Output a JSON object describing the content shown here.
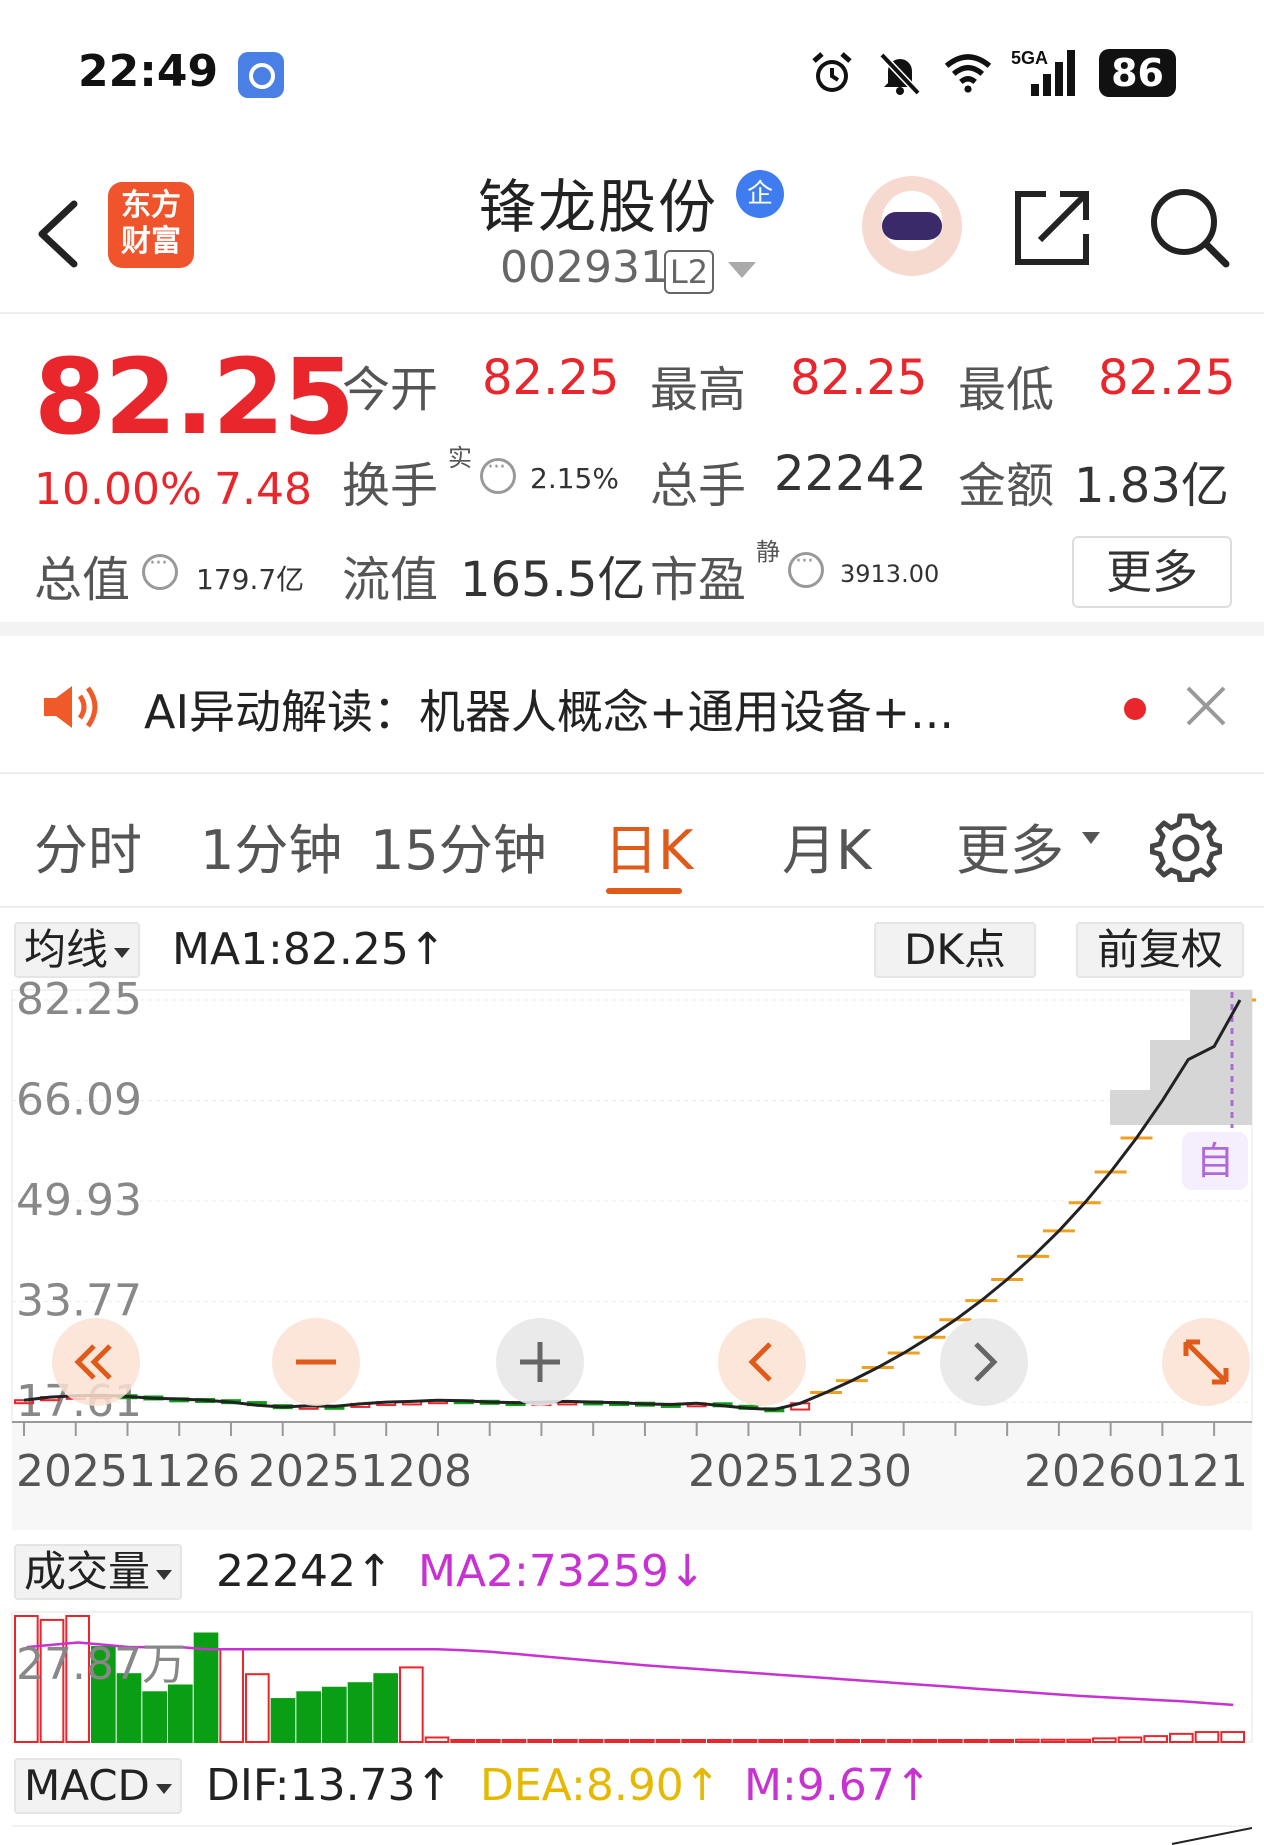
{
  "status": {
    "time": "22:49",
    "battery": "86",
    "net": "5GA"
  },
  "header": {
    "logo_line1": "东方",
    "logo_line2": "财富",
    "stock_name": "锋龙股份",
    "ent_badge": "企",
    "stock_code": "002931",
    "level": "L2"
  },
  "quote": {
    "price": "82.25",
    "change_pct": "10.00%",
    "change_amt": "7.48",
    "open_label": "今开",
    "open": "82.25",
    "high_label": "最高",
    "high": "82.25",
    "low_label": "最低",
    "low": "82.25",
    "turnover_label": "换手",
    "turnover_sup": "实",
    "turnover": "2.15%",
    "volume_label": "总手",
    "volume": "22242",
    "amount_label": "金额",
    "amount": "1.83亿",
    "mktcap_label": "总值",
    "mktcap": "179.7亿",
    "float_label": "流值",
    "float": "165.5亿",
    "pe_label": "市盈",
    "pe_sup": "静",
    "pe": "3913.00",
    "more": "更多"
  },
  "news": {
    "text": "AI异动解读：机器人概念+通用设备+..."
  },
  "tabs": [
    {
      "label": "分时"
    },
    {
      "label": "1分钟"
    },
    {
      "label": "15分钟"
    },
    {
      "label": "日K"
    },
    {
      "label": "月K"
    },
    {
      "label": "更多"
    }
  ],
  "kline": {
    "selector": "均线",
    "ma1": "MA1:82.25↑",
    "dk": "DK点",
    "adjust": "前复权",
    "auto": "自"
  },
  "volume_panel": {
    "selector": "成交量",
    "value": "22242↑",
    "ma2": "MA2:73259↓",
    "ylabel": "27.87万"
  },
  "macd_panel": {
    "selector": "MACD",
    "dif": "DIF:13.73↑",
    "dea": "DEA:8.90↑",
    "m": "M:9.67↑"
  },
  "colors": {
    "up": "#e8262c",
    "down": "#0a9e14",
    "accent": "#e05a1a",
    "ma_line": "#222222",
    "ma2": "#c832d2",
    "dea": "#e6b800"
  },
  "chart_data": [
    {
      "type": "candlestick",
      "ylim": [
        17.61,
        82.25
      ],
      "yticks": [
        "82.25",
        "66.09",
        "49.93",
        "33.77",
        "17.61"
      ],
      "xticks": [
        "20251126",
        "20251208",
        "20251230",
        "20260121"
      ],
      "closes": [
        17.9,
        18.4,
        18.6,
        18.7,
        18.5,
        18.2,
        18.1,
        17.9,
        17.6,
        17.1,
        16.8,
        17.0,
        16.9,
        17.3,
        17.6,
        17.7,
        17.9,
        17.8,
        17.6,
        17.5,
        17.6,
        17.7,
        17.6,
        17.5,
        17.3,
        17.2,
        17.4,
        17.0,
        16.6,
        16.4,
        17.4,
        19.14,
        21.05,
        23.16,
        25.48,
        28.03,
        30.83,
        33.91,
        37.3,
        41.03,
        45.13,
        49.64,
        54.6,
        60.06,
        66.07,
        72.68,
        74.77,
        82.25
      ],
      "ma1_label": "MA1"
    },
    {
      "type": "bar",
      "name": "成交量",
      "ylim": [
        0,
        27.87
      ],
      "values": [
        27.87,
        27.0,
        27.87,
        21.0,
        15.0,
        11.0,
        12.5,
        24.0,
        20.5,
        15.0,
        9.5,
        11.0,
        12.0,
        13.0,
        15.0,
        16.5,
        1.0,
        0.3,
        0.3,
        0.3,
        0.3,
        0.3,
        0.3,
        0.3,
        0.3,
        0.3,
        0.3,
        0.3,
        0.3,
        0.3,
        0.3,
        0.3,
        0.3,
        0.3,
        0.3,
        0.3,
        0.3,
        0.3,
        0.3,
        0.5,
        0.5,
        0.5,
        0.8,
        1.0,
        1.3,
        1.8,
        2.2,
        2.2
      ],
      "up": [
        true,
        true,
        true,
        false,
        false,
        false,
        false,
        false,
        true,
        true,
        false,
        false,
        false,
        false,
        false,
        true,
        true,
        true,
        true,
        true,
        true,
        true,
        true,
        true,
        true,
        true,
        true,
        true,
        true,
        true,
        true,
        true,
        true,
        true,
        true,
        true,
        true,
        true,
        true,
        true,
        true,
        true,
        true,
        true,
        true,
        true,
        true,
        true
      ],
      "ma2": [
        21,
        21.5,
        22,
        21.5,
        21,
        21,
        21,
        20.5,
        20.5,
        20.5,
        20.5,
        20.5,
        20.5,
        20.5,
        20.5,
        20.5,
        20.5,
        20.3,
        20.0,
        19.5,
        19.0,
        18.5,
        18.0,
        17.5,
        17.0,
        16.6,
        16.2,
        15.8,
        15.4,
        15.0,
        14.6,
        14.2,
        13.8,
        13.4,
        13.0,
        12.6,
        12.2,
        11.8,
        11.4,
        11.0,
        10.6,
        10.2,
        9.9,
        9.6,
        9.3,
        9.0,
        8.6,
        8.2
      ]
    }
  ]
}
